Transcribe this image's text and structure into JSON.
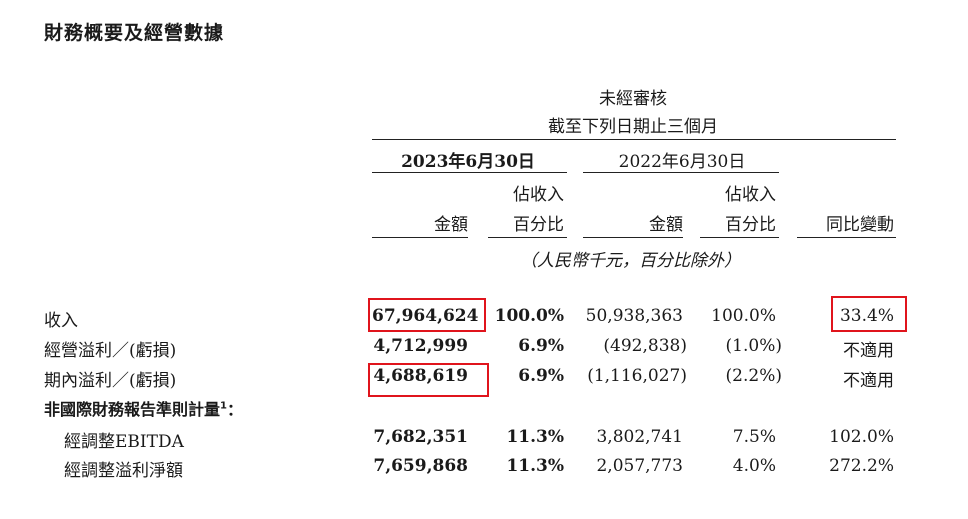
{
  "title": "財務概要及經營數據",
  "header": {
    "unaudited": "未經審核",
    "period": "截至下列日期止三個月",
    "date_2023": "2023年6月30日",
    "date_2022": "2022年6月30日",
    "amount": "金額",
    "pct_line1": "佔收入",
    "pct_line2": "百分比",
    "amount_2022": "金額",
    "pct2_line1": "佔收入",
    "pct2_line2": "百分比",
    "yoy": "同比變動",
    "unit_note": "（人民幣千元，百分比除外）"
  },
  "rows": [
    {
      "label": "收入",
      "amt23": "67,964,624",
      "pct23": "100.0%",
      "amt22": "50,938,363",
      "pct22": "100.0%",
      "yoy": "33.4%"
    },
    {
      "label": "經營溢利／(虧損)",
      "amt23": "4,712,999",
      "pct23": "6.9%",
      "amt22": "(492,838)",
      "pct22": "(1.0%)",
      "yoy": "不適用"
    },
    {
      "label": "期內溢利／(虧損)",
      "amt23": "4,688,619",
      "pct23": "6.9%",
      "amt22": "(1,116,027)",
      "pct22": "(2.2%)",
      "yoy": "不適用"
    },
    {
      "label": "經調整EBITDA",
      "amt23": "7,682,351",
      "pct23": "11.3%",
      "amt22": "3,802,741",
      "pct22": "7.5%",
      "yoy": "102.0%"
    },
    {
      "label": "經調整溢利淨額",
      "amt23": "7,659,868",
      "pct23": "11.3%",
      "amt22": "2,057,773",
      "pct22": "4.0%",
      "yoy": "272.2%"
    }
  ],
  "non_ifrs_label": "非國際財務報告準則計量",
  "non_ifrs_sup": "1",
  "non_ifrs_colon": "：",
  "highlight_color": "#e0141c"
}
